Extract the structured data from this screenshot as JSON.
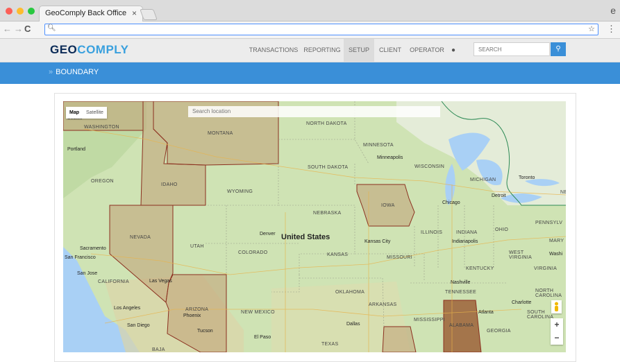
{
  "browser": {
    "tab_title": "GeoComply Back Office",
    "tab_close": "×",
    "nav_back": "←",
    "nav_forward": "→",
    "nav_reload": "C",
    "address_value": "",
    "menu": "⋮",
    "profile": "e"
  },
  "app": {
    "logo_part1": "GEO",
    "logo_part2": "COMPLY",
    "nav": [
      "TRANSACTIONS",
      "REPORTING",
      "SETUP",
      "CLIENT",
      "OPERATOR"
    ],
    "active_nav": "SETUP",
    "search_placeholder": "SEARCH",
    "page_title": "BOUNDARY",
    "breadcrumb_marker": "»"
  },
  "map": {
    "type_map": "Map",
    "type_satellite": "Satellite",
    "search_placeholder": "Search location",
    "zoom_in": "+",
    "zoom_out": "−",
    "country_label": "United States",
    "state_labels": [
      "WASHINGTON",
      "MONTANA",
      "NORTH DAKOTA",
      "MINNESOTA",
      "OREGON",
      "IDAHO",
      "SOUTH DAKOTA",
      "WYOMING",
      "WISCONSIN",
      "MICHIGAN",
      "IOWA",
      "NEBRASKA",
      "NEVADA",
      "UTAH",
      "COLORADO",
      "KANSAS",
      "ILLINOIS",
      "INDIANA",
      "OHIO",
      "PENNSYLV",
      "MISSOURI",
      "CALIFORNIA",
      "WEST VIRGINIA",
      "MARY",
      "KENTUCKY",
      "VIRGINIA",
      "ARIZONA",
      "NEW MEXICO",
      "OKLAHOMA",
      "TENNESSEE",
      "NORTH CAROLINA",
      "ARKANSAS",
      "SOUTH CAROLINA",
      "MISSISSIPPI",
      "ALABAMA",
      "GEORGIA",
      "TEXAS",
      "BAJA",
      "NE"
    ],
    "city_labels": [
      "Seattle",
      "Portland",
      "Minneapolis",
      "Toronto",
      "Detroit",
      "Chicago",
      "Denver",
      "Sacramento",
      "San Francisco",
      "San Jose",
      "Kansas City",
      "Indianapolis",
      "Washi",
      "Las Vegas",
      "Los Angeles",
      "San Diego",
      "Phoenix",
      "Tucson",
      "El Paso",
      "Dallas",
      "Nashville",
      "Charlotte",
      "Atlanta"
    ],
    "boundary_color": "#8b2f1f",
    "highlight_fill": "rgba(193,160,118,0.55)",
    "alabama_fill": "rgba(150,80,40,0.75)"
  }
}
